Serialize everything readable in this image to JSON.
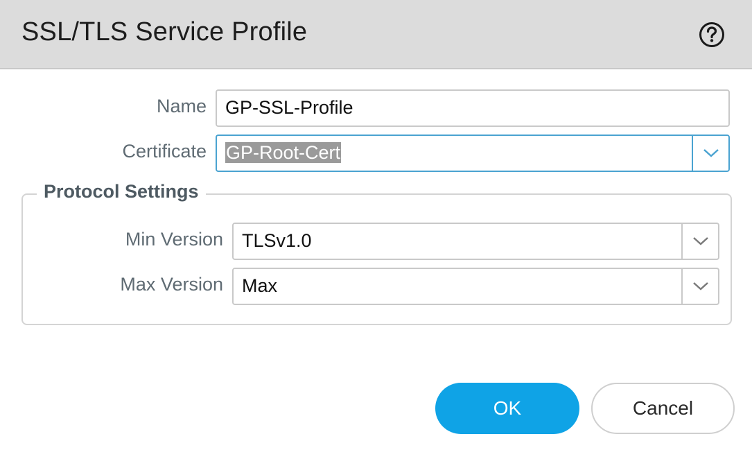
{
  "dialog": {
    "title": "SSL/TLS Service Profile",
    "help_icon": "question-circle-icon"
  },
  "form": {
    "name_label": "Name",
    "name_value": "GP-SSL-Profile",
    "certificate_label": "Certificate",
    "certificate_value": "GP-Root-Cert",
    "certificate_icon": "chevron-down-icon"
  },
  "protocol_settings": {
    "legend": "Protocol Settings",
    "min_version_label": "Min Version",
    "min_version_value": "TLSv1.0",
    "max_version_label": "Max Version",
    "max_version_value": "Max",
    "dropdown_icon": "chevron-down-icon"
  },
  "buttons": {
    "ok_label": "OK",
    "cancel_label": "Cancel"
  },
  "colors": {
    "header_bg": "#dcdcdc",
    "primary_button": "#0fa3e6",
    "focus_border": "#4aa3d1",
    "label_text": "#5f6b73"
  }
}
